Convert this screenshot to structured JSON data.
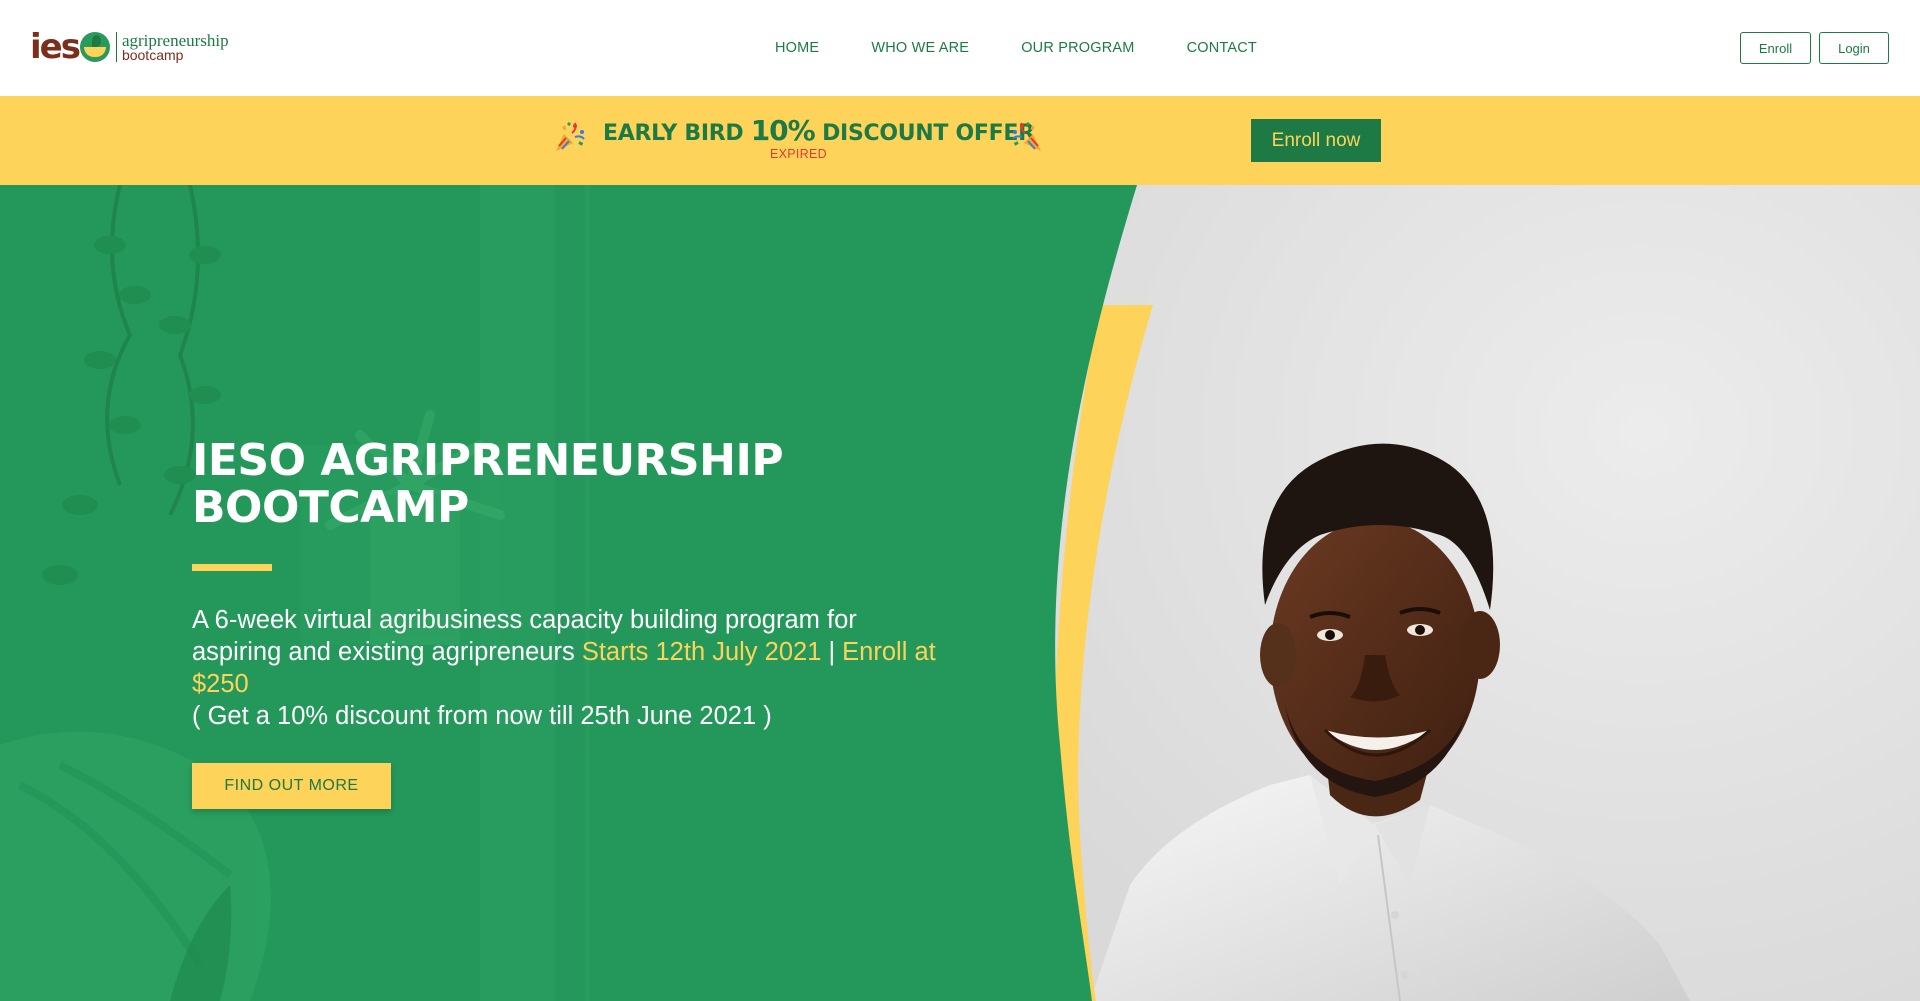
{
  "header": {
    "logo": {
      "mark": "ies",
      "line1": "agripreneurship",
      "line2": "bootcamp"
    },
    "nav": [
      {
        "label": "HOME"
      },
      {
        "label": "WHO WE ARE"
      },
      {
        "label": "OUR PROGRAM"
      },
      {
        "label": "CONTACT"
      }
    ],
    "enroll_label": "Enroll",
    "login_label": "Login"
  },
  "banner": {
    "offer_prefix": "EARLY BIRD ",
    "offer_percent": "10%",
    "offer_suffix": " DISCOUNT OFFER",
    "expired": "EXPIRED",
    "cta_label": "Enroll now",
    "icons": [
      "party-popper-icon",
      "party-popper-icon"
    ]
  },
  "hero": {
    "title_line1": "IESO AGRIPRENEURSHIP",
    "title_line2": "BOOTCAMP",
    "desc_part1": "A 6-week virtual agribusiness capacity building program for aspiring and existing agripreneurs ",
    "desc_highlight1": "Starts 12th July 2021",
    "desc_sep": " | ",
    "desc_highlight2": "Enroll at $250",
    "desc_discount": "( Get a 10% discount from now till 25th June 2021 )",
    "cta_label": "FIND OUT MORE"
  },
  "colors": {
    "brand_green": "#1e7a45",
    "hero_green": "#24985a",
    "accent_yellow": "#fdd35a",
    "expired_red": "#e53935",
    "logo_brown": "#7a2e1c"
  }
}
